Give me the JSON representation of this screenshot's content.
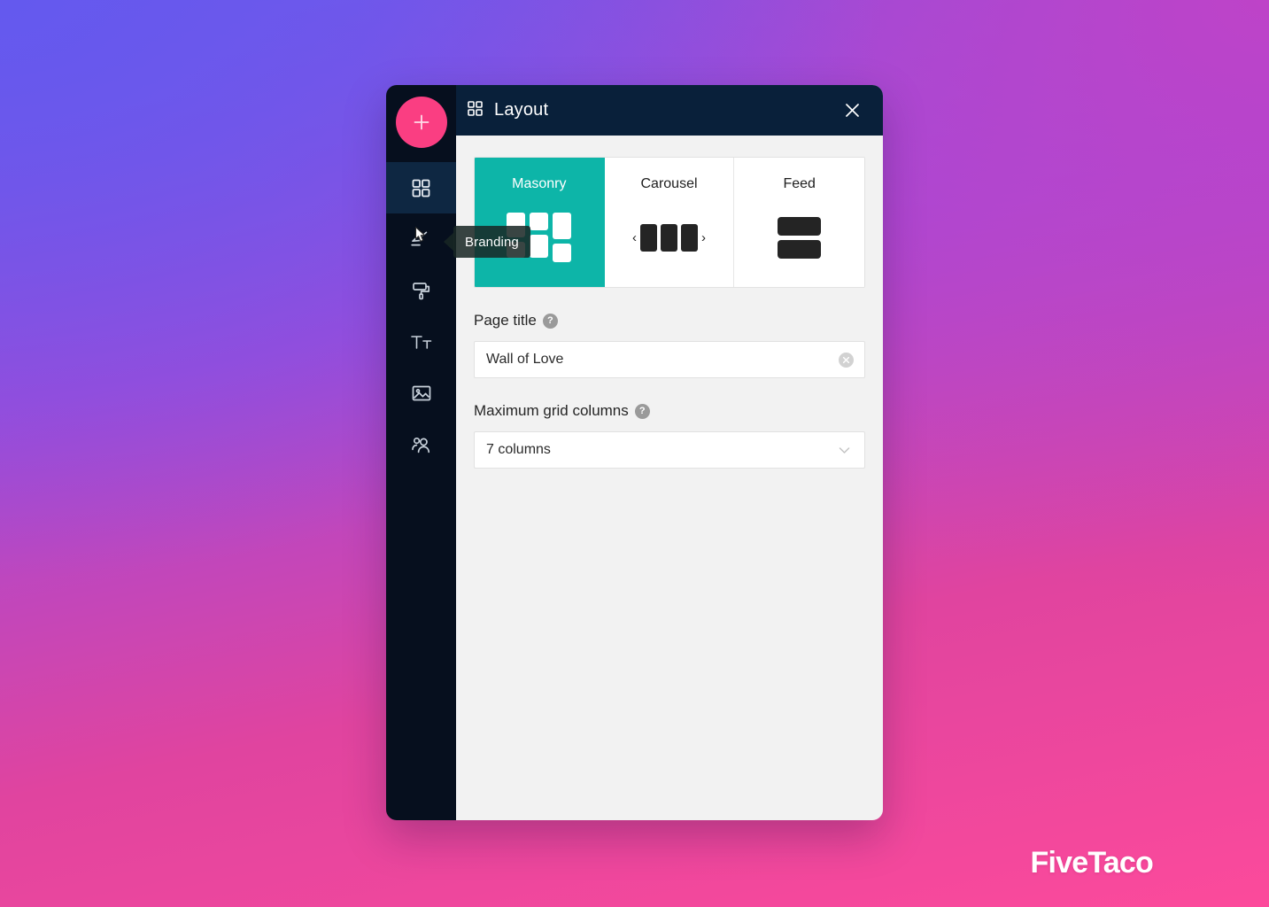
{
  "app": {
    "add_button_icon": "plus-icon",
    "sidebar": {
      "items": [
        {
          "label": "Layout",
          "icon": "grid-icon",
          "active": true
        },
        {
          "label": "Branding",
          "icon": "megaphone-icon",
          "active": false
        },
        {
          "label": "Theme",
          "icon": "paint-roller-icon",
          "active": false
        },
        {
          "label": "Text",
          "icon": "text-icon",
          "active": false
        },
        {
          "label": "Media",
          "icon": "image-icon",
          "active": false
        },
        {
          "label": "People",
          "icon": "people-icon",
          "active": false
        }
      ]
    },
    "tooltip": {
      "text": "Branding",
      "icon": "cursor-pointer-icon"
    }
  },
  "panel": {
    "header": {
      "icon": "grid-icon",
      "title": "Layout",
      "close_icon": "close-icon"
    },
    "layout_options": [
      {
        "label": "Masonry",
        "art": "masonry-art",
        "selected": true
      },
      {
        "label": "Carousel",
        "art": "carousel-art",
        "selected": false
      },
      {
        "label": "Feed",
        "art": "feed-art",
        "selected": false
      }
    ],
    "page_title_field": {
      "label": "Page title",
      "help": "?",
      "value": "Wall of Love",
      "placeholder": "Page title",
      "clear_icon": "clear-circle-icon"
    },
    "grid_columns_field": {
      "label": "Maximum grid columns",
      "help": "?",
      "value": "7 columns",
      "chevron_icon": "chevron-down-icon"
    }
  },
  "watermark": {
    "text": "FiveTaco"
  },
  "colors": {
    "accent_teal": "#0DB5A8",
    "accent_pink": "#FA3E82",
    "header_navy": "#09203A",
    "rail_navy": "#060F1E",
    "rail_active": "#0E2742",
    "panel_bg": "#F2F2F2"
  }
}
